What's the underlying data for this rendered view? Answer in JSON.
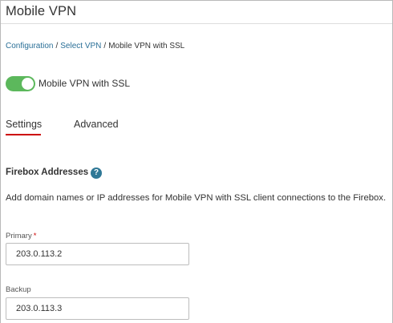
{
  "header": {
    "title": "Mobile VPN"
  },
  "breadcrumb": {
    "items": [
      {
        "label": "Configuration",
        "link": true
      },
      {
        "label": "Select VPN",
        "link": true
      },
      {
        "label": "Mobile VPN with SSL",
        "link": false
      }
    ],
    "separator": "/"
  },
  "toggle": {
    "label": "Mobile VPN with SSL",
    "enabled": true,
    "color": "#5cb85c"
  },
  "tabs": [
    {
      "label": "Settings",
      "active": true
    },
    {
      "label": "Advanced",
      "active": false
    }
  ],
  "accent_colors": {
    "active_tab_underline": "#cc0000",
    "link": "#2a6f97",
    "help_icon": "#2f7896"
  },
  "section": {
    "title": "Firebox Addresses",
    "help_icon": "question-icon",
    "help_glyph": "?",
    "description": "Add domain names or IP addresses for Mobile VPN with SSL client connections to the Firebox."
  },
  "fields": {
    "primary": {
      "label": "Primary",
      "required_marker": "*",
      "value": "203.0.113.2"
    },
    "backup": {
      "label": "Backup",
      "value": "203.0.113.3"
    }
  }
}
